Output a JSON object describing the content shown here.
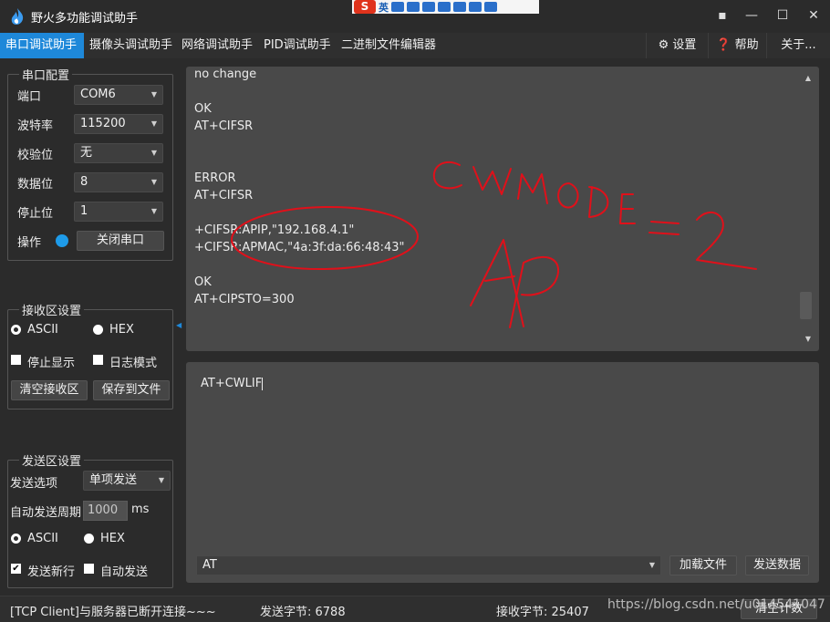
{
  "window": {
    "title": "野火多功能调试助手",
    "min_label": "—",
    "max_label": "☐",
    "close_label": "✕",
    "pin_label": "▪"
  },
  "ime": {
    "logo": "S",
    "mode": "英"
  },
  "menu": {
    "tabs": [
      "串口调试助手",
      "摄像头调试助手",
      "网络调试助手",
      "PID调试助手",
      "二进制文件编辑器"
    ],
    "settings": "⚙ 设置",
    "help": "❓ 帮助",
    "about": "关于..."
  },
  "serial": {
    "title": "串口配置",
    "port_label": "端口",
    "port_value": "COM6",
    "baud_label": "波特率",
    "baud_value": "115200",
    "parity_label": "校验位",
    "parity_value": "无",
    "databits_label": "数据位",
    "databits_value": "8",
    "stopbits_label": "停止位",
    "stopbits_value": "1",
    "op_label": "操作",
    "close_button": "关闭串口"
  },
  "receive": {
    "title": "接收区设置",
    "ascii": "ASCII",
    "hex": "HEX",
    "stop_display": "停止显示",
    "log_mode": "日志模式",
    "clear_button": "清空接收区",
    "save_button": "保存到文件",
    "lines": [
      "no change",
      "",
      "OK",
      "AT+CIFSR",
      "",
      "",
      "ERROR",
      "AT+CIFSR",
      "",
      "+CIFSR:APIP,\"192.168.4.1\"",
      "+CIFSR:APMAC,\"4a:3f:da:66:48:43\"",
      "",
      "OK",
      "AT+CIPSTO=300"
    ]
  },
  "send_settings": {
    "title": "发送区设置",
    "option_label": "发送选项",
    "option_value": "单项发送",
    "period_label": "自动发送周期",
    "period_value": "1000",
    "period_unit": "ms",
    "ascii": "ASCII",
    "hex": "HEX",
    "newline": "发送新行",
    "auto_send": "自动发送"
  },
  "send": {
    "text": "AT+CWLIF",
    "command": "AT",
    "load_button": "加载文件",
    "send_button": "发送数据"
  },
  "status": {
    "connection": "[TCP Client]与服务器已断开连接~~~",
    "sent": "发送字节: 6788",
    "received": "接收字节: 25407",
    "clear_count": "清空计数",
    "watermark": "https://blog.csdn.net/u014541047"
  },
  "colors": {
    "accent": "#1e88d9",
    "annotation": "#e0101a"
  }
}
